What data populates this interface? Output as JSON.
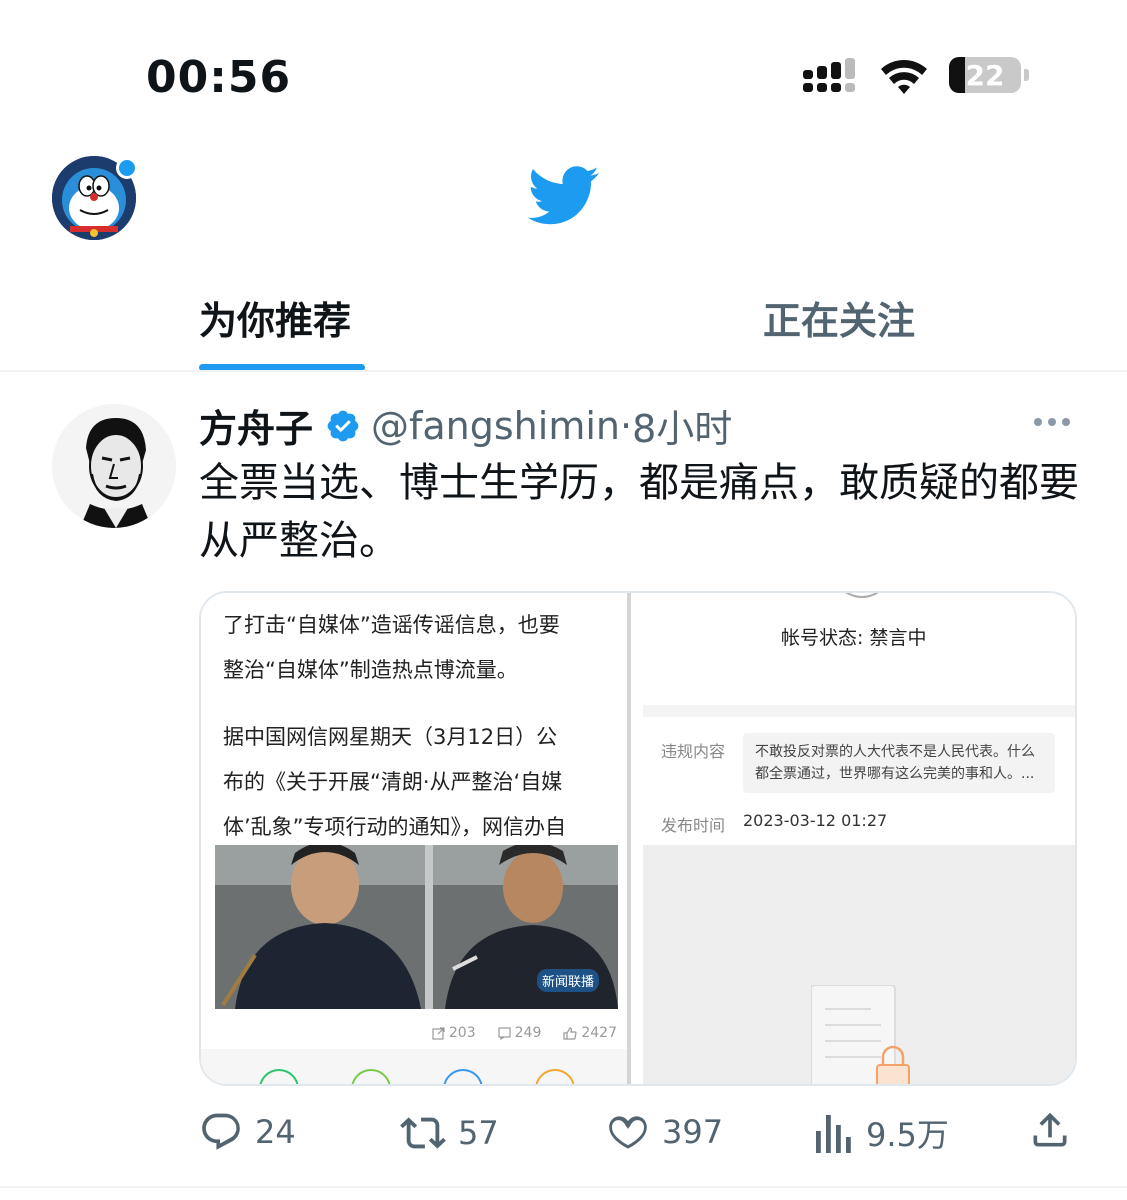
{
  "status_bar": {
    "time": "00:56",
    "battery": "22"
  },
  "tabs": [
    {
      "label": "为你推荐",
      "active": true
    },
    {
      "label": "正在关注",
      "active": false
    }
  ],
  "tweet": {
    "author_name": "方舟子",
    "handle": "@fangshimin",
    "separator": "·",
    "time": "8小时",
    "text": "全票当选、博士生学历，都是痛点，敢质疑的都要从严整治。"
  },
  "media": {
    "article_lines": [
      "了打击“自媒体”造谣传谣信息，也要",
      "整治“自媒体”制造热点博流量。",
      "据中国网信网星期天（3月12日）公",
      "布的《关于开展“清朗·从严整治‘自媒",
      "体’乱象”专项行动的通知》，网信办自"
    ],
    "video_logo": "新闻联播",
    "stats": {
      "shares": "203",
      "comments": "249",
      "likes": "2427"
    },
    "account_status": "帐号状态:  禁言中",
    "violation_label": "违规内容",
    "violation_text": "不敢投反对票的人大代表不是人民代表。什么都全票通过，世界哪有这么完美的事和人。...",
    "publish_label": "发布时间",
    "publish_time": "2023-03-12 01:27"
  },
  "actions": {
    "replies": "24",
    "retweets": "57",
    "likes": "397",
    "views": "9.5万"
  },
  "colors": {
    "accent": "#1d9bf0",
    "text": "#0f1419",
    "secondary": "#536471"
  }
}
